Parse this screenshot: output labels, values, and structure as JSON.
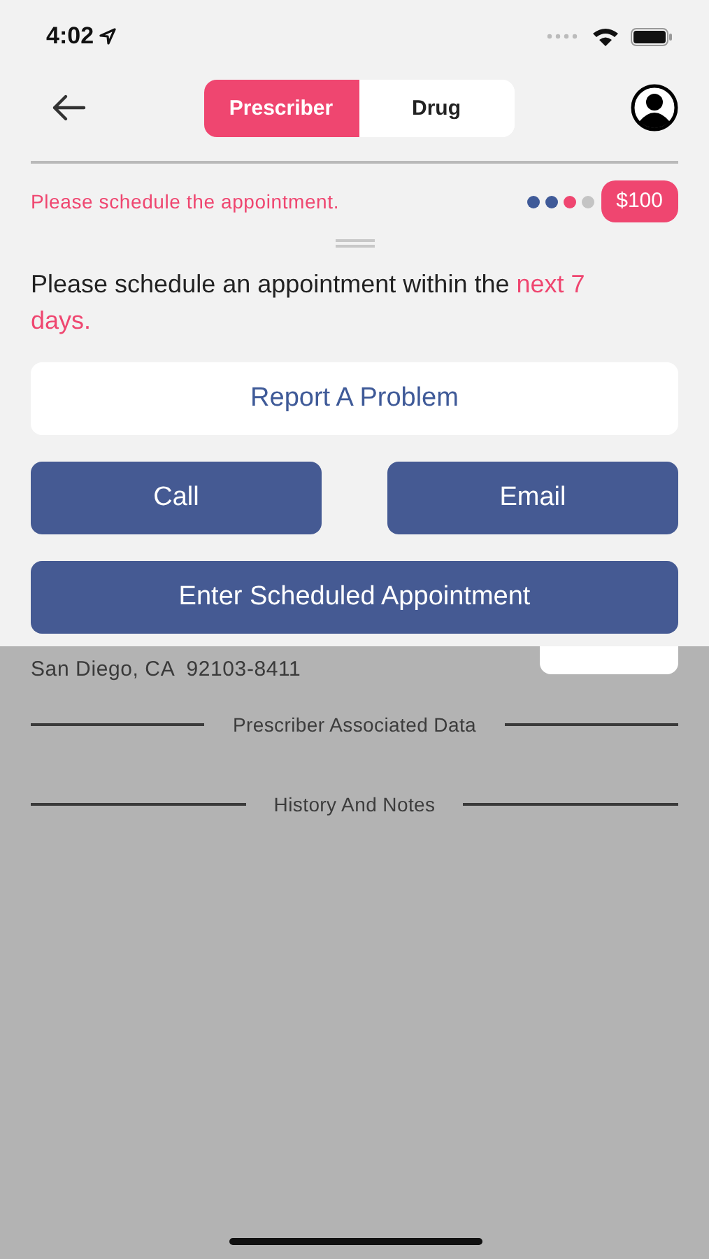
{
  "status_bar": {
    "time": "4:02"
  },
  "segments": [
    {
      "label": "Prescriber",
      "selected": true
    },
    {
      "label": "Drug",
      "selected": false
    }
  ],
  "notice": {
    "text": "Please schedule the appointment.",
    "badge": "$100"
  },
  "progress_dots": [
    {
      "color": "#3f5a98"
    },
    {
      "color": "#3f5a98"
    },
    {
      "color": "#ef4670"
    },
    {
      "color": "#c4c4c4"
    }
  ],
  "instruction": {
    "text": "Please schedule an appointment within the",
    "highlight": "next 7 days."
  },
  "actions": [
    {
      "label": "Report A Problem",
      "kind": "outline"
    },
    {
      "label": "Call",
      "kind": "primary"
    },
    {
      "label": "Email",
      "kind": "primary"
    },
    {
      "label": "Enter Scheduled Appointment",
      "kind": "primary"
    }
  ],
  "address": [
    "San Diego, CA  92103-8411"
  ],
  "sections": [
    "Prescriber Associated Data",
    "History And Notes"
  ]
}
